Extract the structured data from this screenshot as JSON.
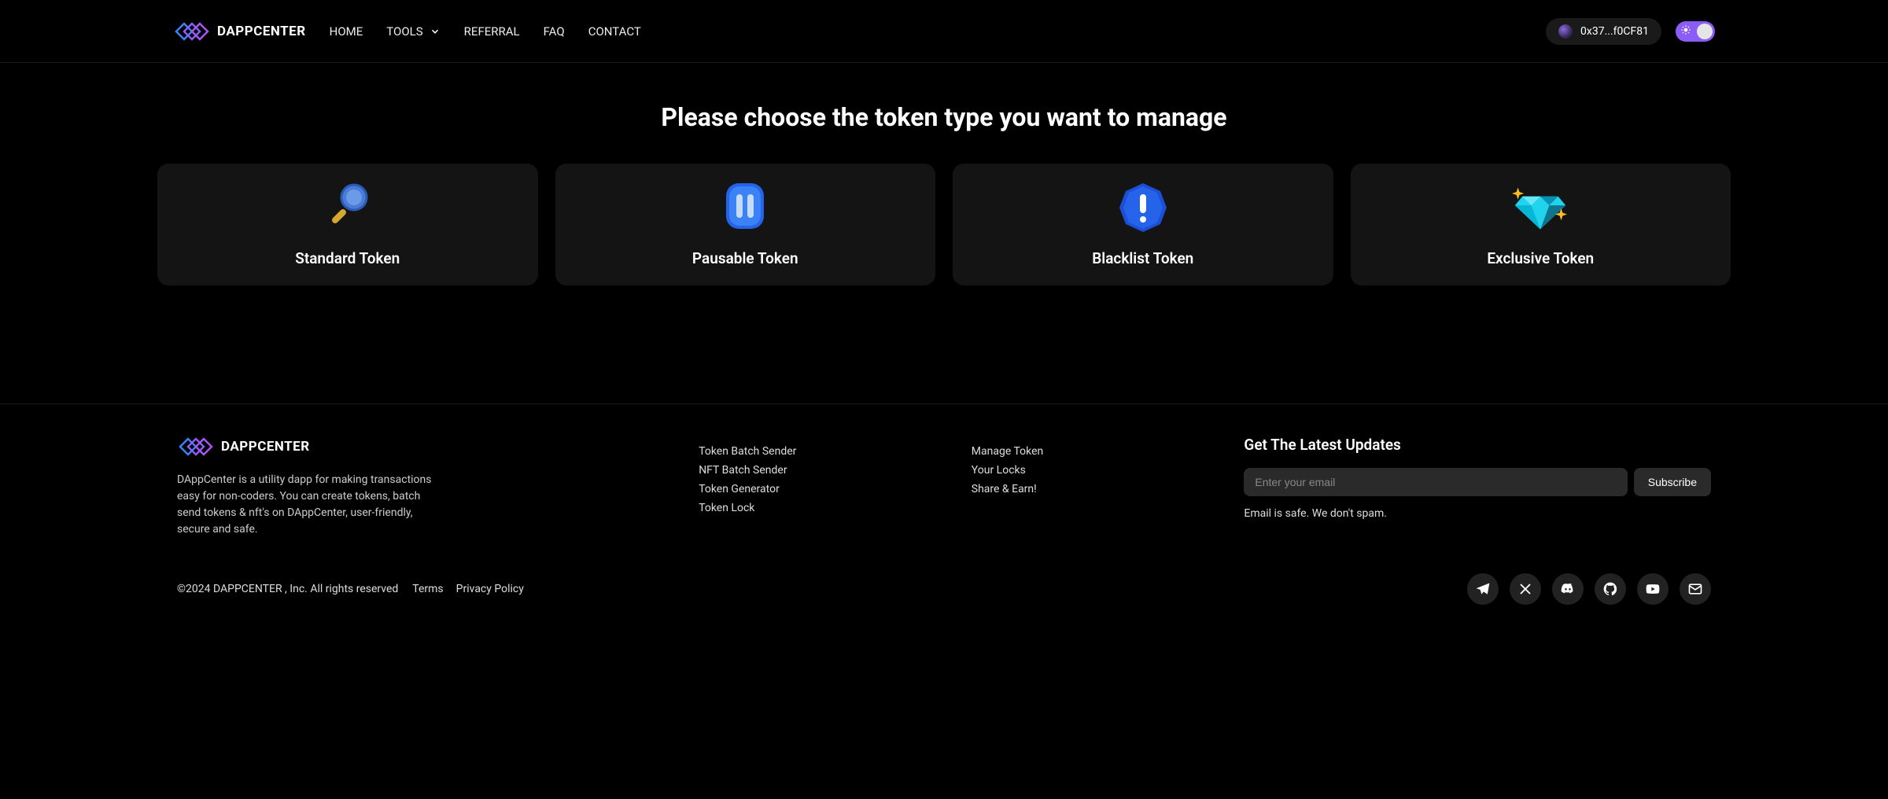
{
  "header": {
    "logo_text": "DAPPCENTER",
    "nav": {
      "home": "HOME",
      "tools": "TOOLS",
      "referral": "REFERRAL",
      "faq": "FAQ",
      "contact": "CONTACT"
    },
    "wallet_address": "0x37...f0CF81"
  },
  "main": {
    "title": "Please choose the token type you want to manage",
    "cards": {
      "standard": "Standard Token",
      "pausable": "Pausable Token",
      "blacklist": "Blacklist Token",
      "exclusive": "Exclusive Token"
    }
  },
  "footer": {
    "logo_text": "DAPPCENTER",
    "about": "DAppCenter is a utility dapp for making transactions easy for non-coders. You can create tokens, batch send tokens & nft's on DAppCenter, user-friendly, secure and safe.",
    "links_col1": {
      "token_batch": "Token Batch Sender",
      "nft_batch": "NFT Batch Sender",
      "token_gen": "Token Generator",
      "token_lock": "Token Lock"
    },
    "links_col2": {
      "manage_token": "Manage Token",
      "your_locks": "Your Locks",
      "share_earn": "Share & Earn!"
    },
    "newsletter": {
      "title": "Get The Latest Updates",
      "placeholder": "Enter your email",
      "button": "Subscribe",
      "note": "Email is safe. We don't spam."
    },
    "copyright": "©2024 DAPPCENTER , Inc. All rights reserved",
    "terms": "Terms",
    "privacy": "Privacy Policy"
  }
}
